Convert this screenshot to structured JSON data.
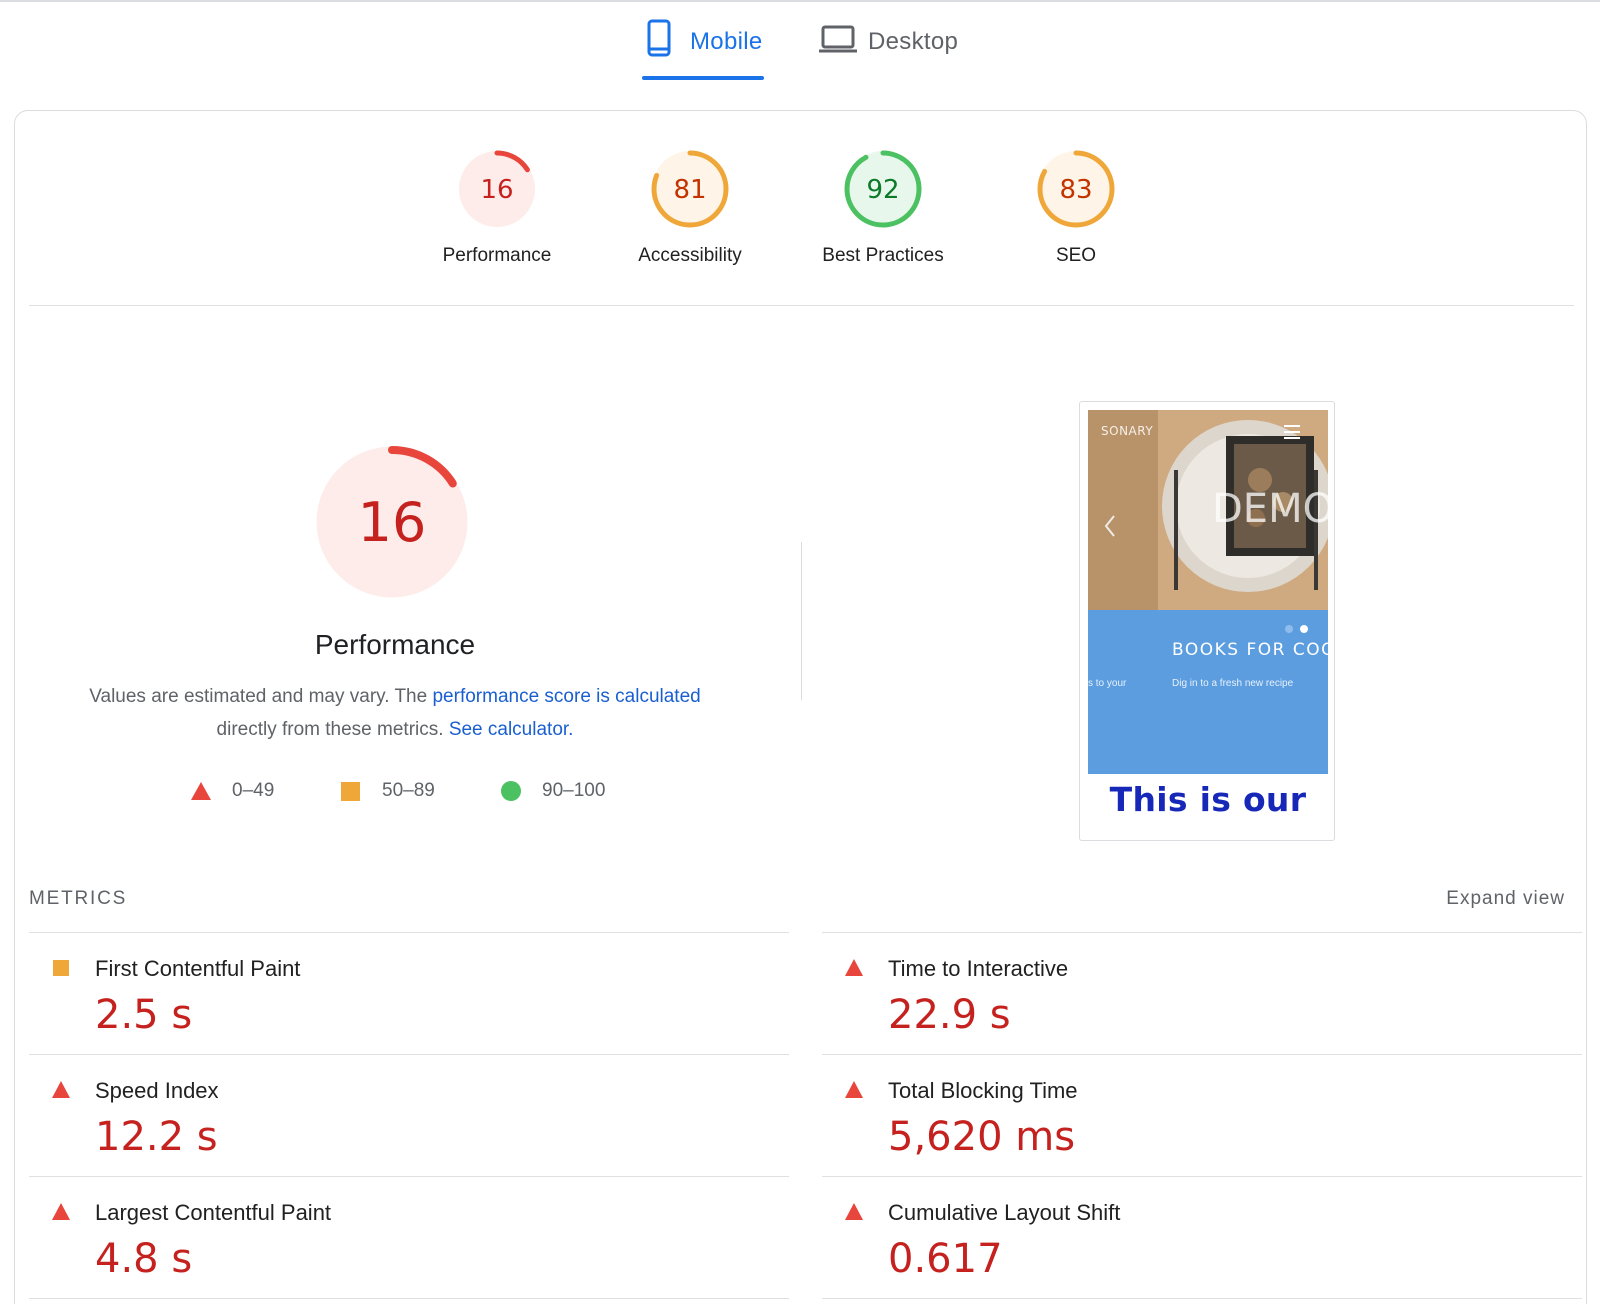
{
  "tabs": {
    "mobile": "Mobile",
    "desktop": "Desktop",
    "active": "mobile"
  },
  "scores": [
    {
      "value": "16",
      "label": "Performance",
      "score": 16,
      "rating": "fail"
    },
    {
      "value": "81",
      "label": "Accessibility",
      "score": 81,
      "rating": "average"
    },
    {
      "value": "92",
      "label": "Best Practices",
      "score": 92,
      "rating": "pass"
    },
    {
      "value": "83",
      "label": "SEO",
      "score": 83,
      "rating": "average"
    }
  ],
  "performance": {
    "score": "16",
    "score_value": 16,
    "title": "Performance",
    "desc_prefix": "Values are estimated and may vary. The ",
    "desc_link": "performance score is calculated",
    "desc_middle": "directly from these metrics. ",
    "desc_link2": "See calculator."
  },
  "legend": [
    {
      "shape": "triangle-icon",
      "range": "0–49"
    },
    {
      "shape": "square-icon",
      "range": "50–89"
    },
    {
      "shape": "circle-icon",
      "range": "90–100"
    }
  ],
  "screenshot": {
    "brand": "SONARY",
    "overlay_text": "DEMO",
    "headline": "BOOKS FOR COO",
    "sub_left": "s to your",
    "sub_right": "Dig in to a fresh new recipe",
    "caption": "This is our"
  },
  "metrics": {
    "header": "METRICS",
    "expand": "Expand view",
    "items": [
      {
        "title": "First Contentful Paint",
        "value": "2.5 s",
        "rating": "average"
      },
      {
        "title": "Time to Interactive",
        "value": "22.9 s",
        "rating": "fail"
      },
      {
        "title": "Speed Index",
        "value": "12.2 s",
        "rating": "fail"
      },
      {
        "title": "Total Blocking Time",
        "value": "5,620 ms",
        "rating": "fail"
      },
      {
        "title": "Largest Contentful Paint",
        "value": "4.8 s",
        "rating": "fail"
      },
      {
        "title": "Cumulative Layout Shift",
        "value": "0.617",
        "rating": "fail"
      }
    ]
  },
  "colors": {
    "fail": "#e8453c",
    "fail_text": "#c5221f",
    "fail_bg": "#fdecea",
    "average": "#f0a73a",
    "average_text": "#c33300",
    "average_bg": "#fef5e8",
    "pass": "#4cc162",
    "pass_text": "#0d7a2a",
    "pass_bg": "#e8f7ec",
    "link": "#1a5fcf",
    "accent": "#1a73e8"
  }
}
